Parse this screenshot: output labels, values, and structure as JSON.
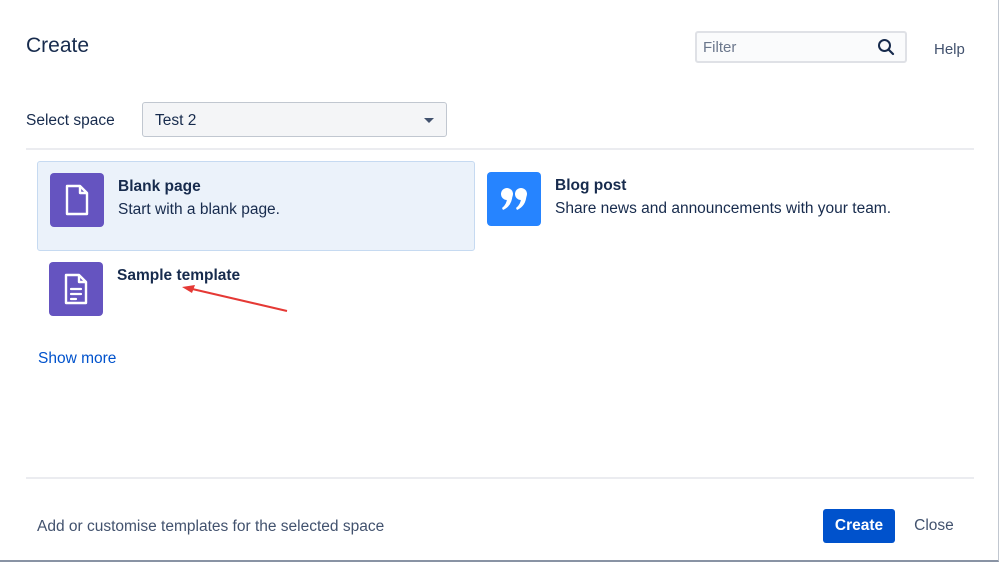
{
  "dialog": {
    "title": "Create",
    "filter_placeholder": "Filter",
    "help_label": "Help"
  },
  "space": {
    "label": "Select space",
    "selected": "Test 2"
  },
  "templates": [
    {
      "name": "Blank page",
      "description": "Start with a blank page.",
      "icon": "blank-page-icon",
      "color": "#6554c0",
      "selected": true
    },
    {
      "name": "Blog post",
      "description": "Share news and announcements with your team.",
      "icon": "blog-quote-icon",
      "color": "#2684ff",
      "selected": false
    },
    {
      "name": "Sample template",
      "description": "",
      "icon": "template-document-icon",
      "color": "#6554c0",
      "selected": false
    }
  ],
  "show_more_label": "Show more",
  "footer": {
    "customise_text": "Add or customise templates for the selected space",
    "create_label": "Create",
    "close_label": "Close"
  },
  "annotation": {
    "color": "#e53935"
  }
}
